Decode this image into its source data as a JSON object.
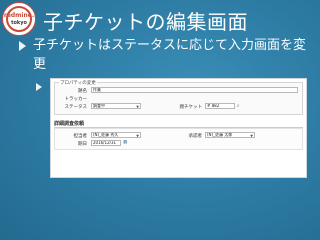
{
  "slide": {
    "title": "子チケットの編集画面",
    "bullet_text": "子チケットはステータスに応じて入力画面を変更",
    "logo": {
      "line1": "redmine.",
      "line2": "tokyo"
    }
  },
  "screenshot": {
    "properties_legend": "プロパティの変更",
    "subject_label": "題名",
    "subject_value": "作業",
    "tracker_label": "トラッカー",
    "tracker_value": "",
    "status_label": "ステータス",
    "status_value": "調査中",
    "parent_label": "親チケット",
    "parent_value": "# 882",
    "section_title": "詳細調査依頼",
    "assignee_label": "担当者",
    "assignee_value": "(N)_佐藤 秀久",
    "reviewer_label": "承認者",
    "reviewer_value": "(N)_佐藤 太郎",
    "due_label": "期日",
    "due_value": "2016/12/31"
  },
  "colors": {
    "background": "#2c7aa2",
    "title_text": "#ffffff",
    "logo_accent": "#c84a3a"
  }
}
